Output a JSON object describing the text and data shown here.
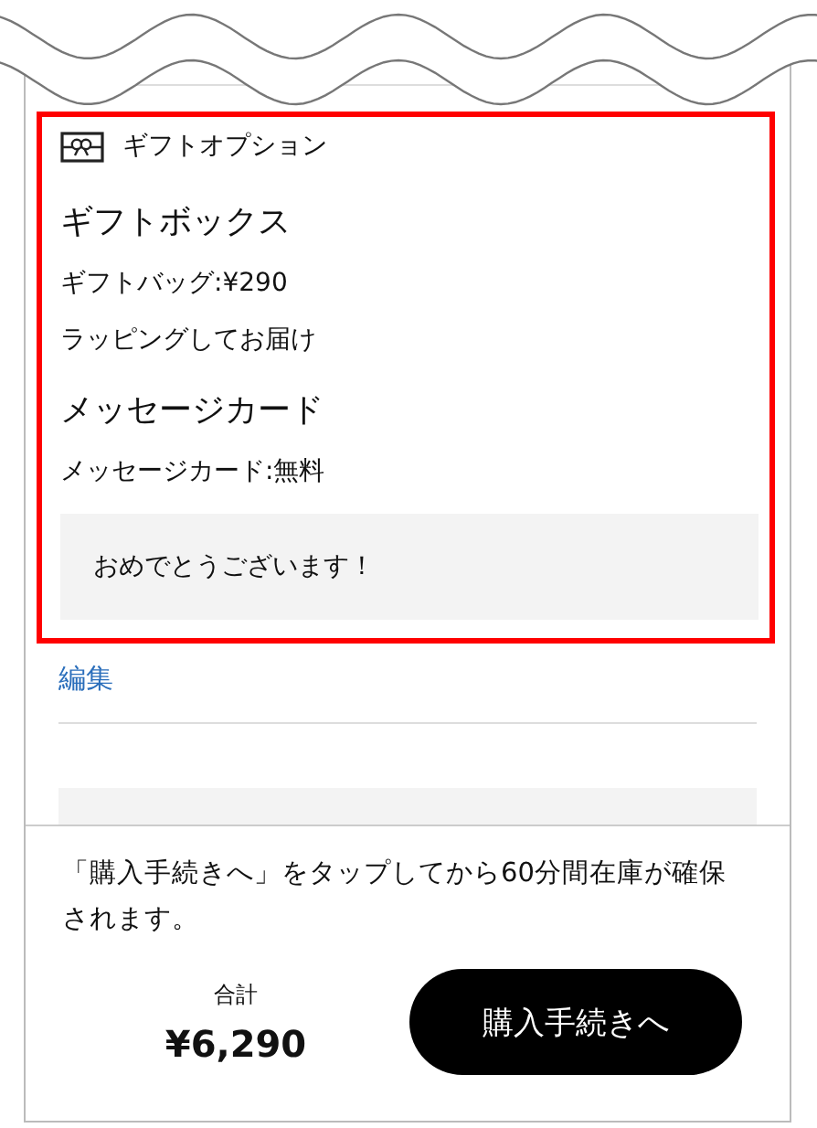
{
  "gift_option": {
    "title": "ギフトオプション",
    "groups": [
      {
        "heading": "ギフトボックス",
        "lines": [
          "ギフトバッグ:¥290",
          "ラッピングしてお届け"
        ]
      },
      {
        "heading": "メッセージカード",
        "lines": [
          "メッセージカード:無料"
        ]
      }
    ],
    "message": "おめでとうございます！"
  },
  "edit_link": "編集",
  "footer": {
    "notice": "「購入手続きへ」をタップしてから60分間在庫が確保されます。",
    "total_label": "合計",
    "total": "¥6,290",
    "checkout_button": "購入手続きへ"
  }
}
